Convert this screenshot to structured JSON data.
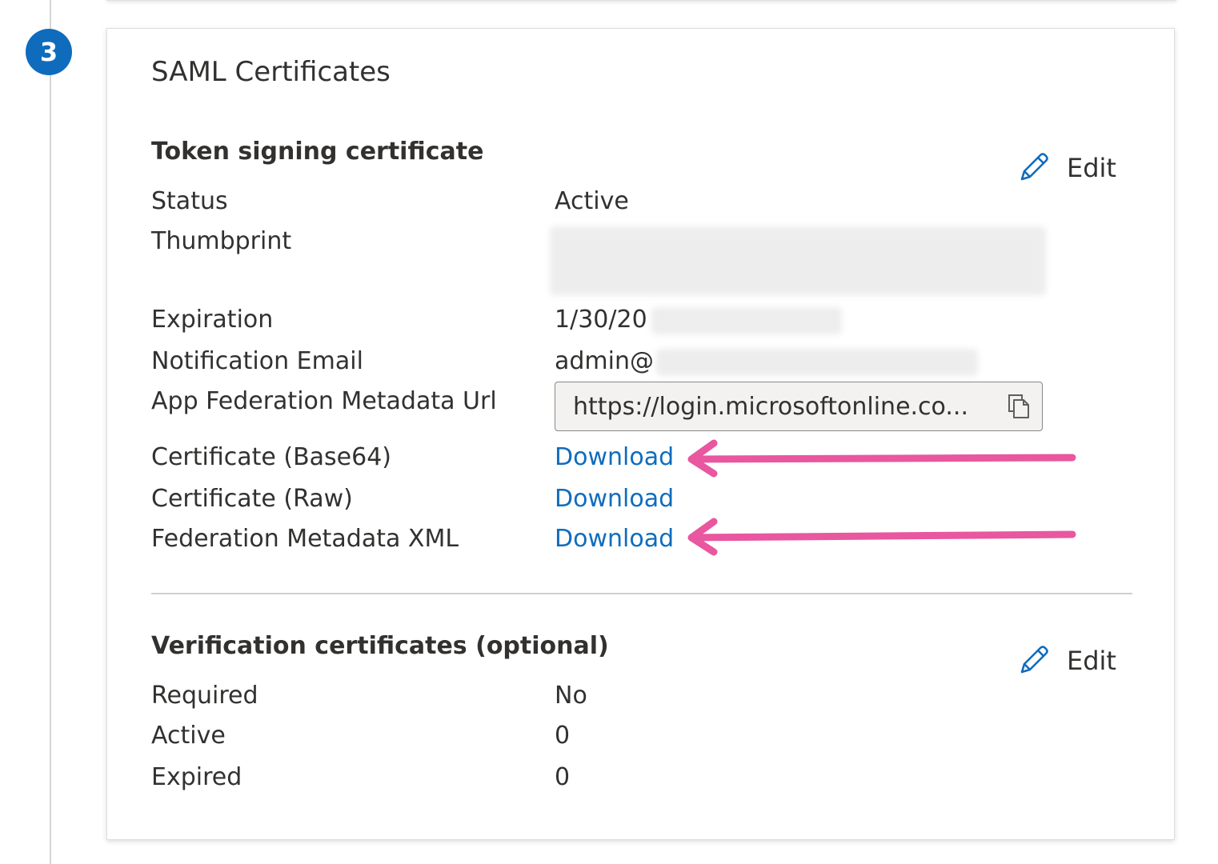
{
  "step": {
    "number": "3"
  },
  "card": {
    "title": "SAML Certificates"
  },
  "token_section": {
    "title": "Token signing certificate",
    "edit_label": "Edit",
    "rows": {
      "status": {
        "label": "Status",
        "value": "Active"
      },
      "thumbprint": {
        "label": "Thumbprint"
      },
      "expiration": {
        "label": "Expiration",
        "value": "1/30/20"
      },
      "notification_email": {
        "label": "Notification Email",
        "value": "admin@"
      },
      "metadata_url": {
        "label": "App Federation Metadata Url",
        "value": "https://login.microsoftonline.co..."
      },
      "cert_base64": {
        "label": "Certificate (Base64)",
        "link": "Download"
      },
      "cert_raw": {
        "label": "Certificate (Raw)",
        "link": "Download"
      },
      "federation_xml": {
        "label": "Federation Metadata XML",
        "link": "Download"
      }
    }
  },
  "verification_section": {
    "title": "Verification certificates (optional)",
    "edit_label": "Edit",
    "rows": {
      "required": {
        "label": "Required",
        "value": "No"
      },
      "active": {
        "label": "Active",
        "value": "0"
      },
      "expired": {
        "label": "Expired",
        "value": "0"
      }
    }
  },
  "colors": {
    "accent": "#0f6cbd",
    "annotation_arrow": "#e8579f"
  },
  "icons": {
    "edit": "pencil-icon",
    "copy": "copy-icon"
  }
}
